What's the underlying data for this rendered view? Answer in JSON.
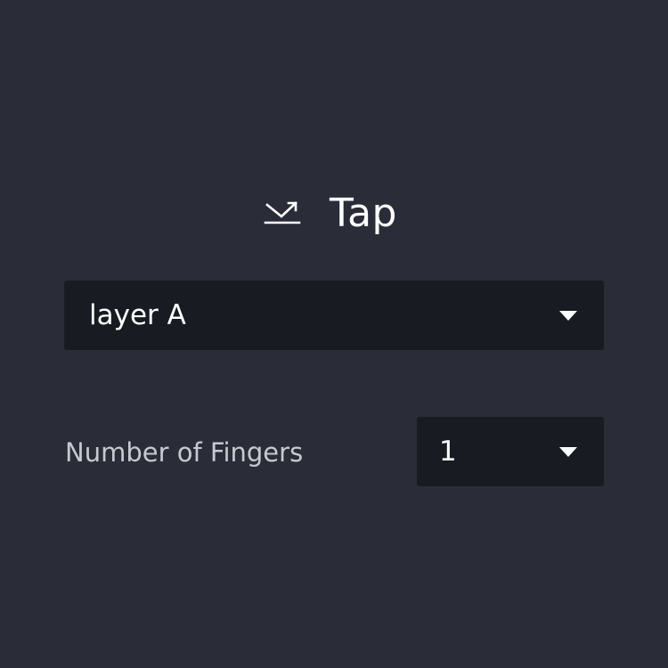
{
  "header": {
    "icon": "tap-gesture-icon",
    "title": "Tap"
  },
  "layer_select": {
    "value": "layer A",
    "icon": "chevron-down-icon"
  },
  "fingers": {
    "label": "Number of Fingers",
    "value": "1",
    "icon": "chevron-down-icon"
  },
  "colors": {
    "background": "#2a2c38",
    "field_background": "#181b21",
    "text": "#ffffff",
    "label_text": "#c7c9d0"
  }
}
